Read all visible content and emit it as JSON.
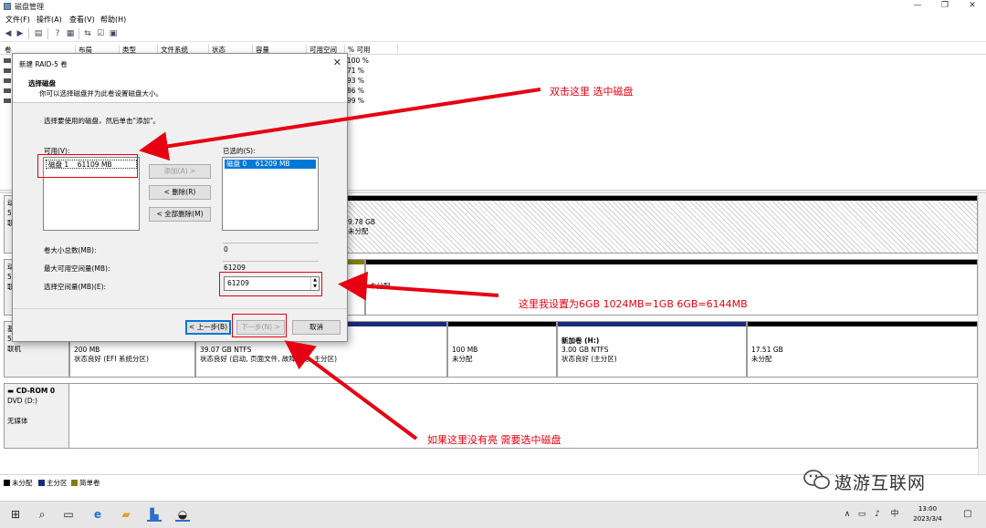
{
  "window": {
    "title": "磁盘管理"
  },
  "menu": [
    "文件(F)",
    "操作(A)",
    "查看(V)",
    "帮助(H)"
  ],
  "volume_list": {
    "columns": [
      "卷",
      "布局",
      "类型",
      "文件系统",
      "状态",
      "容量",
      "可用空间",
      "% 可用"
    ],
    "rows": [
      {
        "pct": "100 %"
      },
      {
        "pct": "71 %"
      },
      {
        "pct": "93 %"
      },
      {
        "pct": "86 %"
      },
      {
        "pct": "99 %"
      }
    ]
  },
  "disks": {
    "d0": {
      "lines": [
        "动",
        "59",
        "联"
      ]
    },
    "d1": {
      "lines": [
        "动",
        "59",
        "联"
      ]
    },
    "d2": {
      "lines": [
        "基",
        "59.88 GB",
        "联机"
      ]
    },
    "cdrom": {
      "name": "CD-ROM 0",
      "drive": "DVD (D:)",
      "status": "无媒体"
    }
  },
  "partitions": {
    "d0_right": {
      "l1": "9.78 GB",
      "l2": "未分配"
    },
    "d1_right": {
      "l1": "",
      "l2": "未分配"
    },
    "efi": {
      "l1": "200 MB",
      "l2": "状态良好 (EFI 系统分区)"
    },
    "c": {
      "l1": "39.07 GB NTFS",
      "l2": "状态良好 (启动, 页面文件, 故障转储, 主分区)"
    },
    "unalloc100": {
      "l1": "100 MB",
      "l2": "未分配"
    },
    "h": {
      "l0": "新加卷 (H:)",
      "l1": "3.00 GB NTFS",
      "l2": "状态良好 (主分区)"
    },
    "unalloc17": {
      "l1": "17.51 GB",
      "l2": "未分配"
    }
  },
  "legend": [
    "未分配",
    "主分区",
    "简单卷"
  ],
  "legend_colors": [
    "#000000",
    "#1a2a7c",
    "#857d10"
  ],
  "dialog": {
    "title": "新建 RAID-5 卷",
    "heading": "选择磁盘",
    "subheading": "你可以选择磁盘并为此卷设置磁盘大小。",
    "instruction": "选择要使用的磁盘，然后单击\"添加\"。",
    "available_label": "可用(V):",
    "available_items": [
      {
        "disk": "磁盘 1",
        "size": "61109 MB"
      }
    ],
    "selected_label": "已选的(S):",
    "selected_items": [
      {
        "disk": "磁盘 0",
        "size": "61209 MB"
      }
    ],
    "add_button": "添加(A) >",
    "remove_button": "< 删除(R)",
    "remove_all_button": "< 全部删除(M)",
    "total_size_label": "卷大小总数(MB):",
    "total_size_value": "0",
    "max_space_label": "最大可用空间量(MB):",
    "max_space_value": "61209",
    "select_space_label": "选择空间量(MB)(E):",
    "select_space_value": "61209",
    "back_button": "< 上一步(B)",
    "next_button": "下一步(N) >",
    "cancel_button": "取消"
  },
  "annotations": {
    "a1": "双击这里 选中磁盘",
    "a2": "这里我设置为6GB 1024MB=1GB 6GB=6144MB",
    "a3": "如果这里没有亮  需要选中磁盘"
  },
  "annotation_color": "#e60012",
  "taskbar": {
    "time": "13:00",
    "date": "2023/3/4",
    "ime": "中"
  },
  "watermark": "遨游互联网"
}
